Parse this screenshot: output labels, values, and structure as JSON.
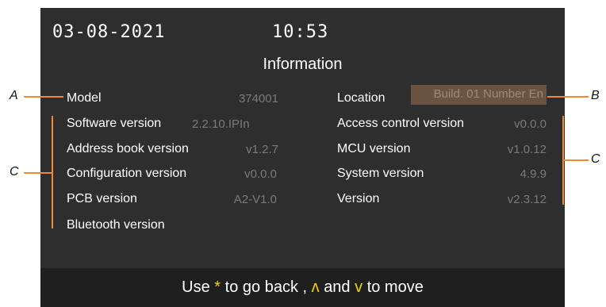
{
  "header": {
    "date": "03-08-2021",
    "time": "10:53"
  },
  "page_title": "Information",
  "left_items": [
    {
      "label": "Model",
      "value": "374001"
    },
    {
      "label": "Software version",
      "value": "2.2.10.IPIn"
    },
    {
      "label": "Address book version",
      "value": "v1.2.7"
    },
    {
      "label": "Configuration version",
      "value": "v0.0.0"
    },
    {
      "label": "PCB version",
      "value": "A2-V1.0"
    },
    {
      "label": "Bluetooth version",
      "value": ""
    }
  ],
  "right_items": [
    {
      "label": "Location",
      "value": "Build. 01 Number En"
    },
    {
      "label": "Access control version",
      "value": "v0.0.0"
    },
    {
      "label": "MCU version",
      "value": "v1.0.12"
    },
    {
      "label": "System version",
      "value": "4.9.9"
    },
    {
      "label": "Version",
      "value": "v2.3.12"
    }
  ],
  "footer": {
    "use": "Use",
    "star": "*",
    "back_text": "to go back ,",
    "up": "ʌ",
    "and": "and",
    "down": "v",
    "move": "to move"
  },
  "callouts": {
    "a": "A",
    "b": "B",
    "c_left": "C",
    "c_right": "C"
  },
  "colors": {
    "screen_bg": "#2e2e2e",
    "footer_bg": "#1f1f1f",
    "value_gray": "#7a7a7a",
    "highlight": "#f0d400",
    "annotation": "#f08a2c",
    "location_field": "#6b5342"
  }
}
